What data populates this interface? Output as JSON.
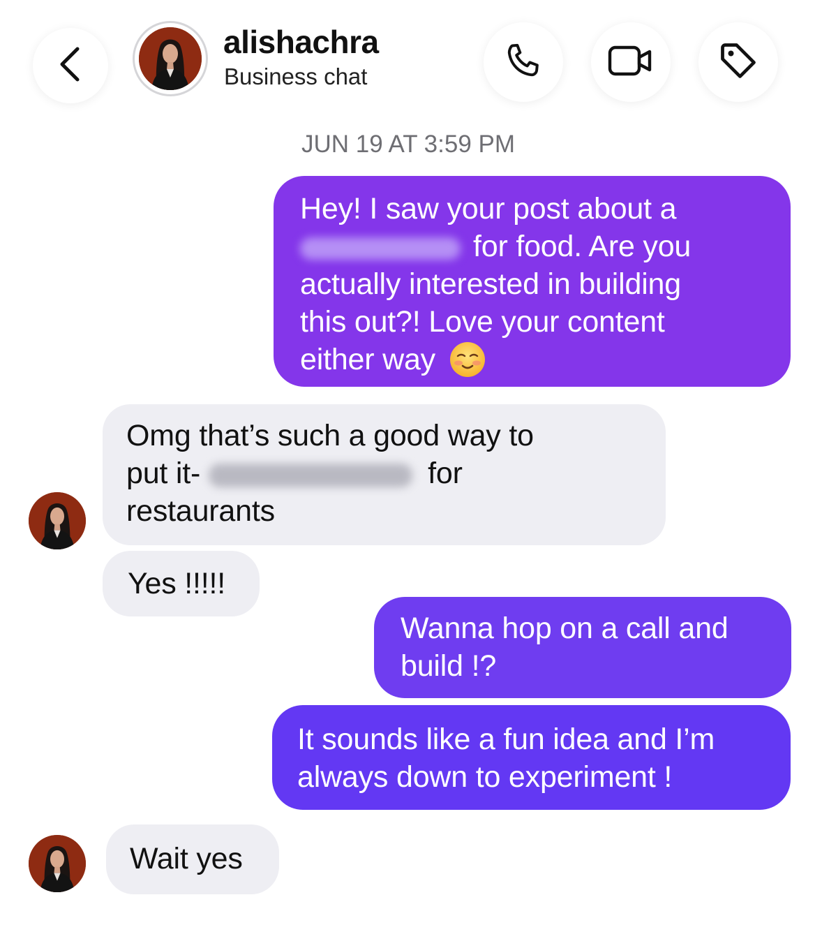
{
  "header": {
    "back_icon": "chevron-left-icon",
    "contact_name": "alishachra",
    "contact_subtitle": "Business chat",
    "actions": [
      {
        "name": "call",
        "icon": "phone-icon"
      },
      {
        "name": "video",
        "icon": "video-camera-icon"
      },
      {
        "name": "labels",
        "icon": "tag-icon"
      }
    ]
  },
  "thread": {
    "timestamp": "JUN 19 AT 3:59 PM",
    "messages": [
      {
        "direction": "outgoing",
        "lines": [
          "Hey! I saw your post about a",
          "for food. Are you",
          "actually interested in building",
          "this out?! Love your content",
          "either way"
        ],
        "has_redacted_text": true,
        "emoji": "smiling-face-with-blush-icon"
      },
      {
        "direction": "incoming",
        "lines": [
          "Omg that’s such a good way to",
          "put it-",
          "for",
          "restaurants"
        ],
        "has_redacted_text": true
      },
      {
        "direction": "incoming",
        "lines": [
          "Yes !!!!!"
        ]
      },
      {
        "direction": "outgoing",
        "lines": [
          "Wanna hop on a call and",
          "build !?"
        ]
      },
      {
        "direction": "outgoing",
        "lines": [
          "It sounds like a fun idea and I’m",
          "always down to experiment !"
        ]
      },
      {
        "direction": "incoming",
        "lines": [
          "Wait yes"
        ]
      }
    ]
  },
  "colors": {
    "outgoing_bubble_1": "#8436ea",
    "outgoing_bubble_2": "#6f3df0",
    "outgoing_bubble_3": "#6338f3",
    "incoming_bubble": "#eeeef3",
    "timestamp_text": "#6e6e73"
  }
}
